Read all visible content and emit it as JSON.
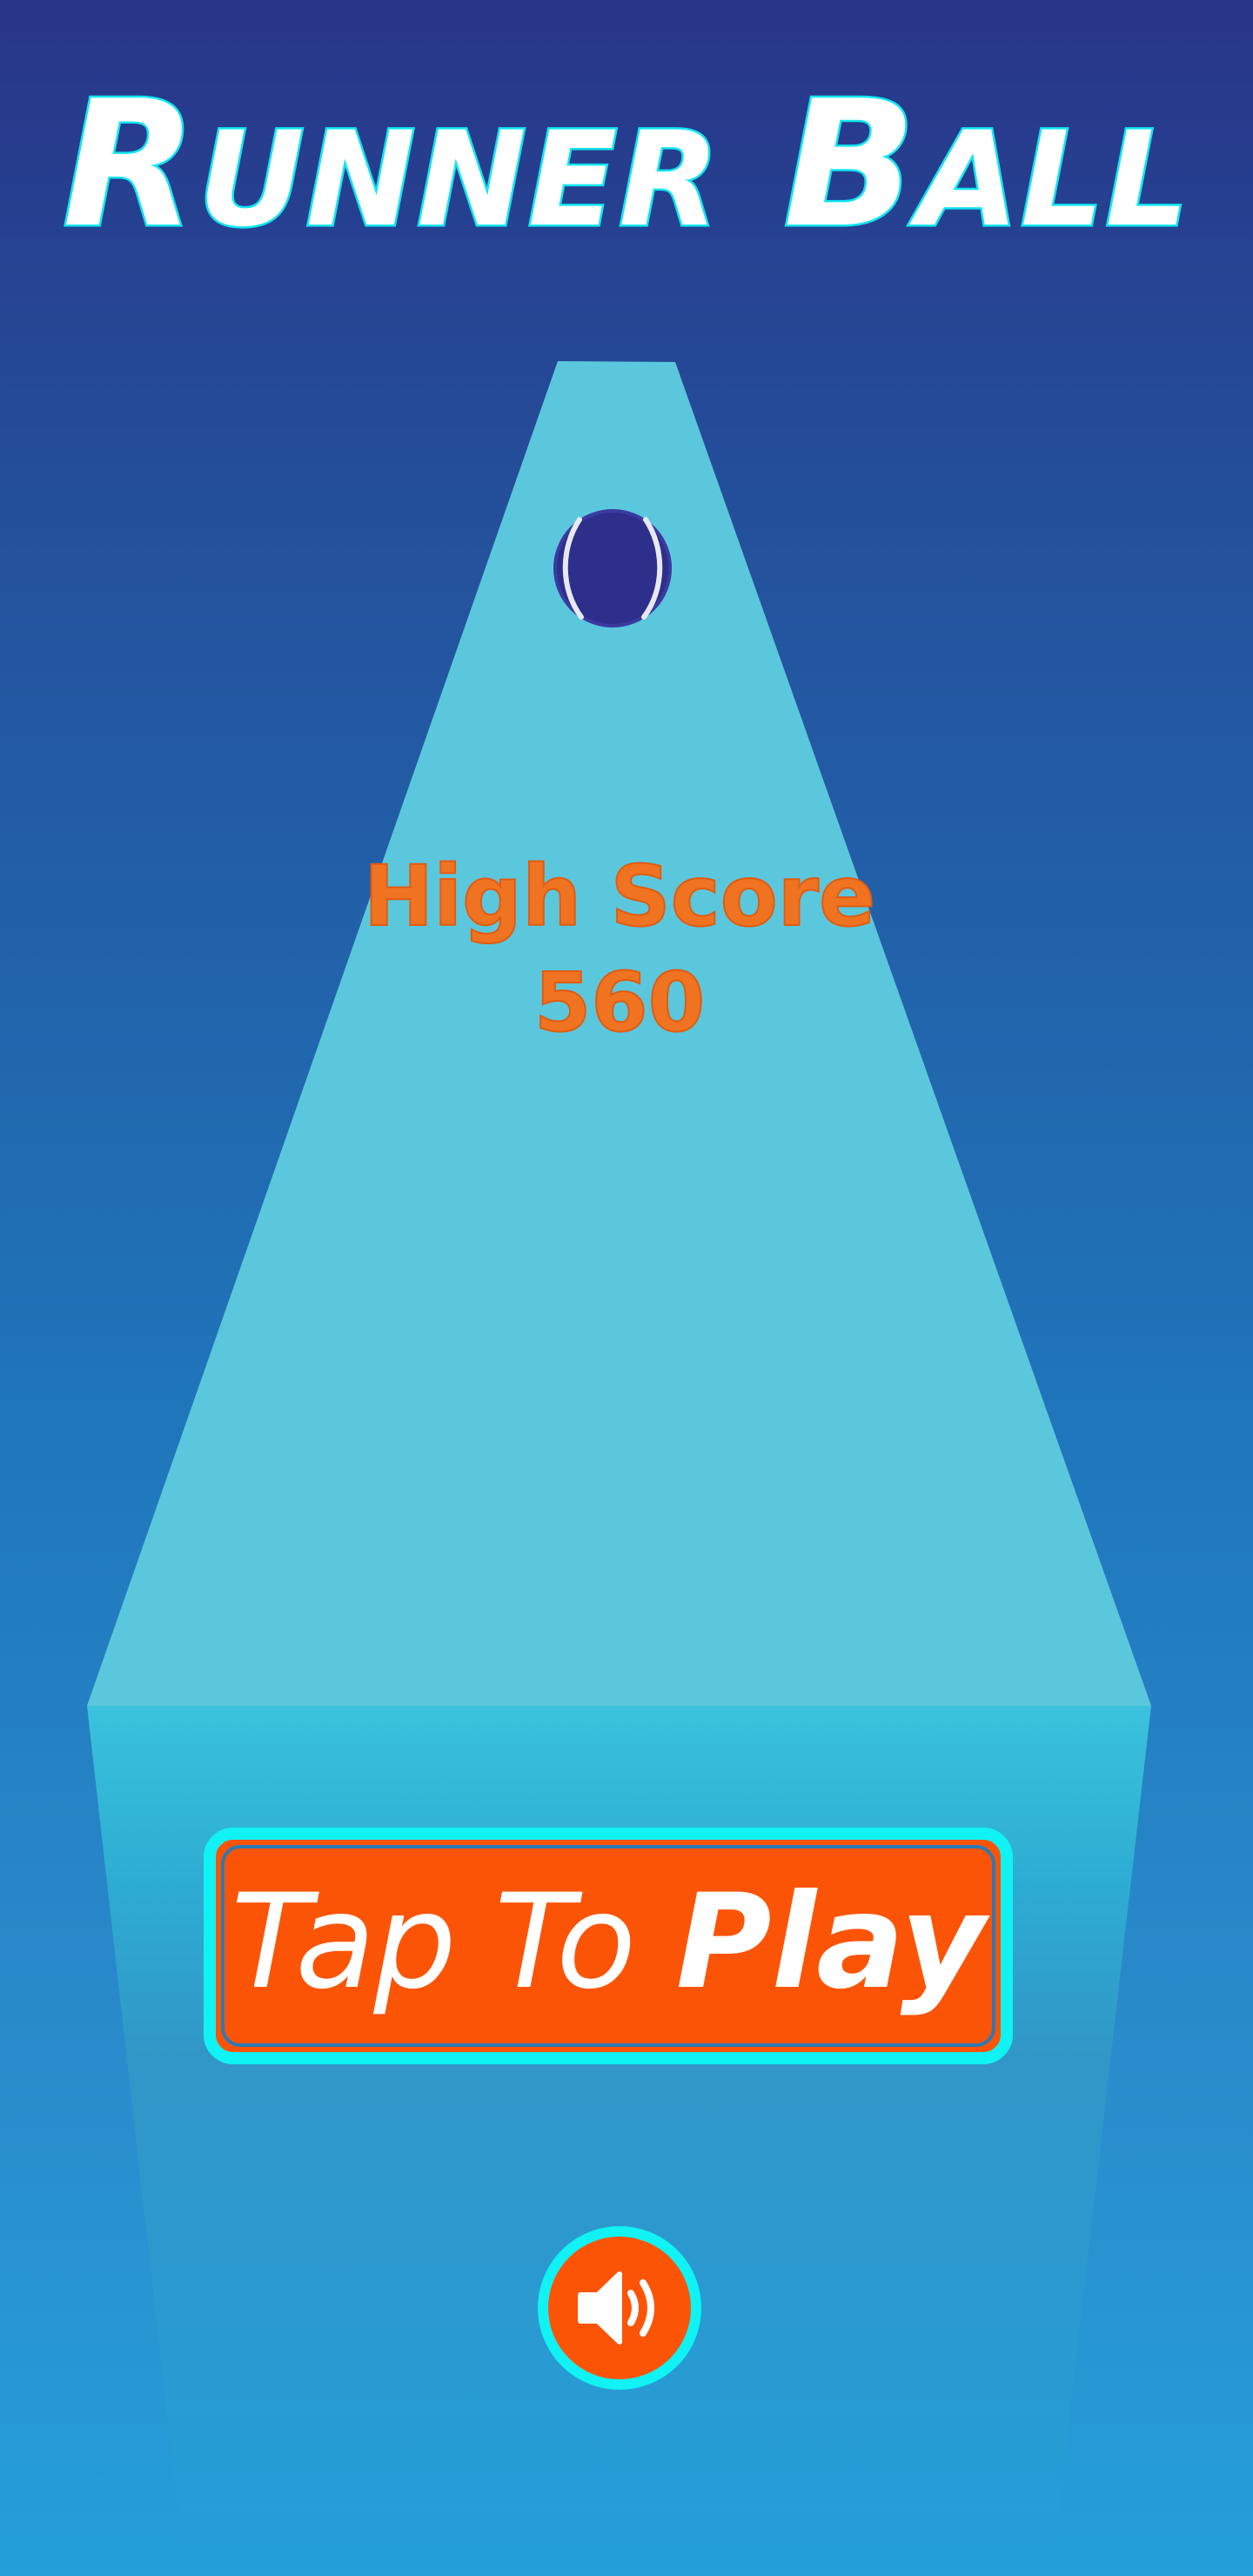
{
  "game": {
    "title_main": "R",
    "title_rest": "UNNER",
    "title_main2": "B",
    "title_rest2": "ALL",
    "high_score_label": "High Score",
    "high_score_value": "560"
  },
  "play_button": {
    "label_light": "Tap To",
    "label_bold": "Play"
  },
  "sound_button": {
    "icon": "speaker-volume-icon",
    "state": "on"
  },
  "colors": {
    "background_top": "#283589",
    "background_bottom": "#249fd9",
    "track": "#5bc7dd",
    "accent_cyan": "#10f2f4",
    "button_orange": "#fc5407",
    "score_orange": "#f07321",
    "ball": "#2e2f8a"
  }
}
